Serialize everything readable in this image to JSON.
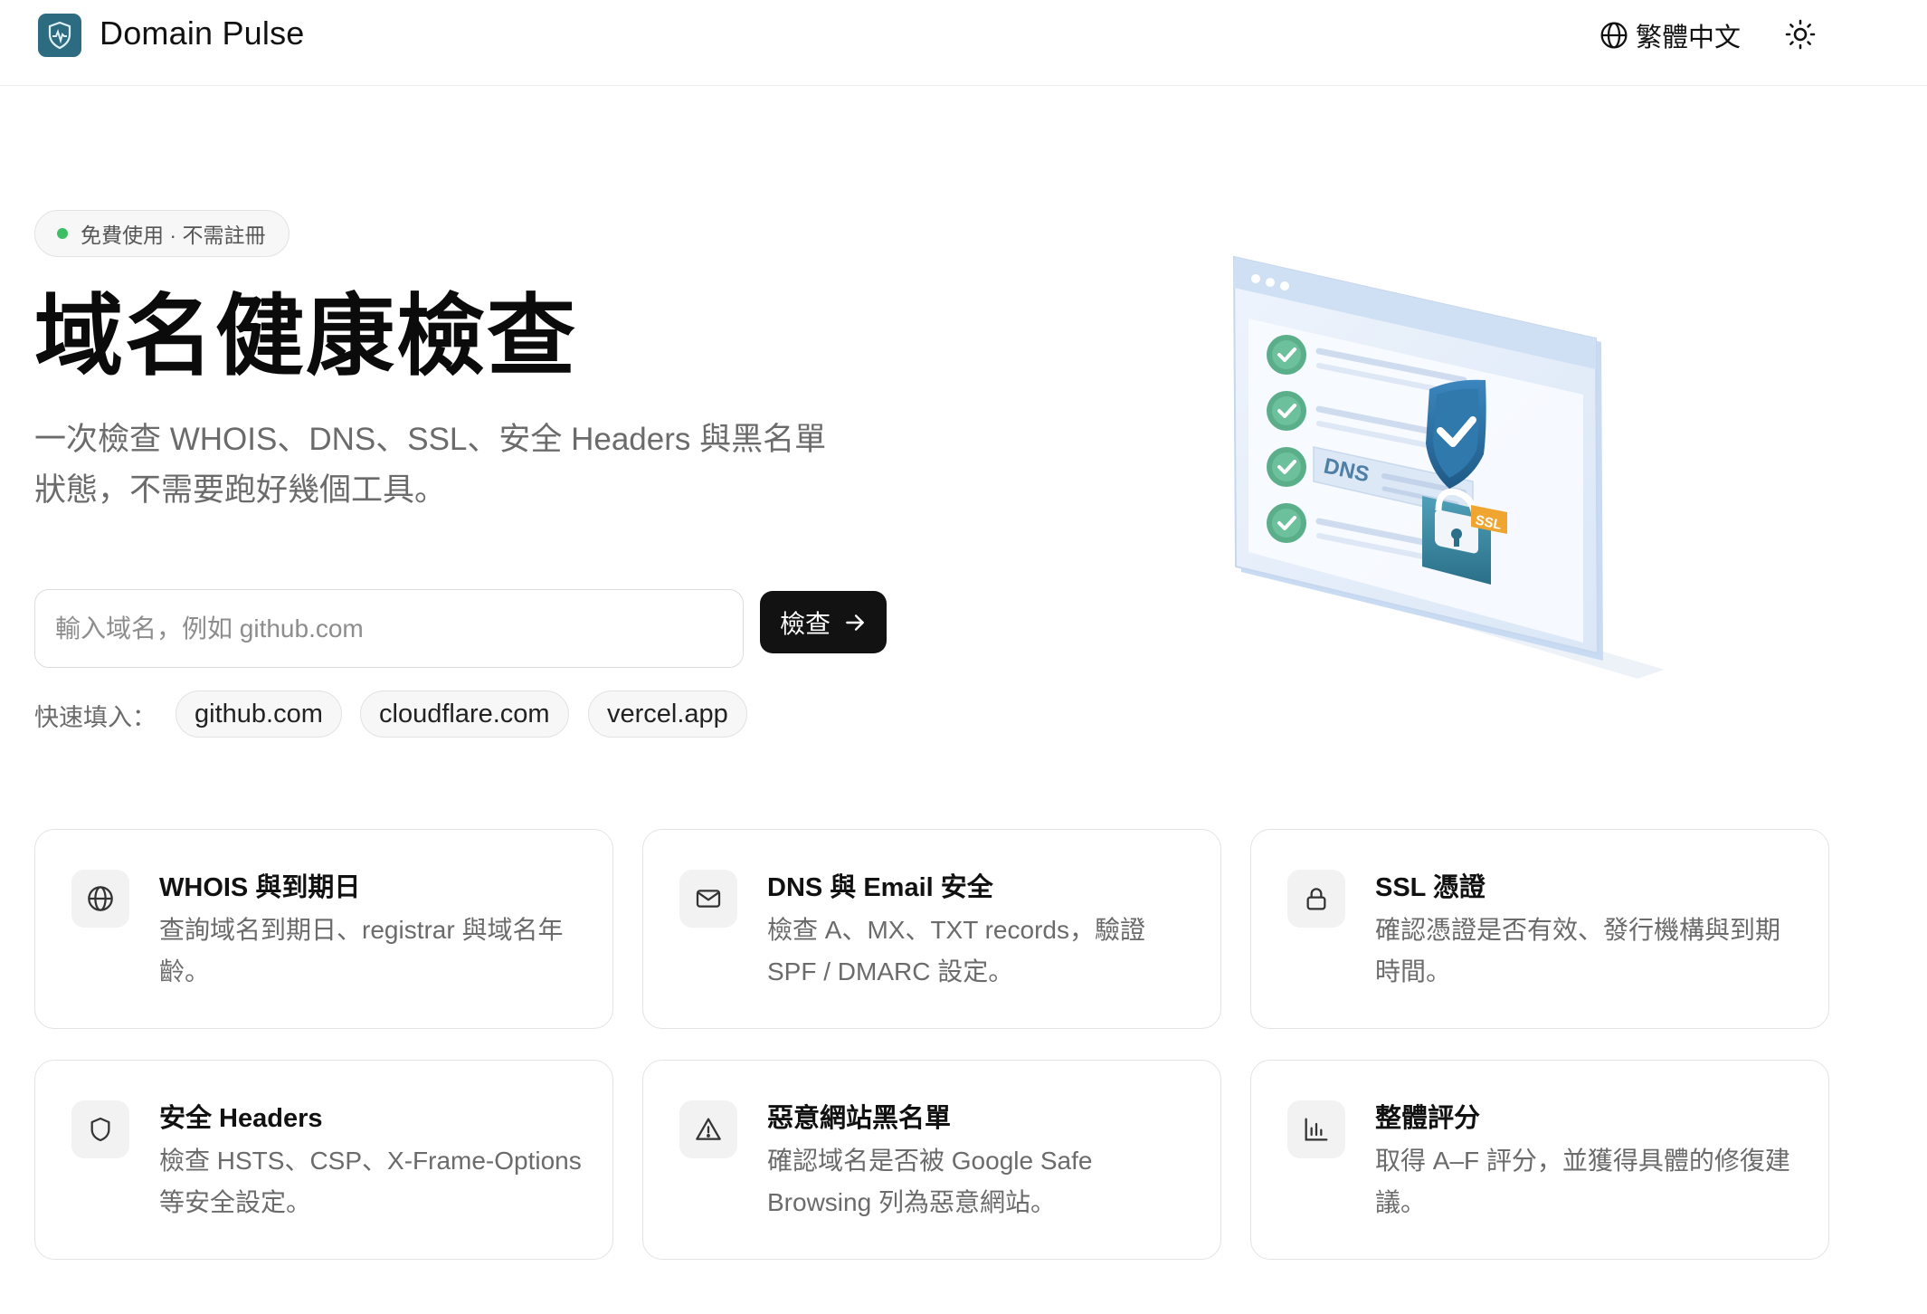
{
  "header": {
    "brand": "Domain Pulse",
    "language": "繁體中文",
    "icons": {
      "logo": "heartbeat-shield-icon",
      "language": "globe-icon",
      "theme": "sun-icon"
    }
  },
  "hero": {
    "badge": "免費使用 · 不需註冊",
    "title": "域名健康檢查",
    "subtitle": "一次檢查 WHOIS、DNS、SSL、安全 Headers 與黑名單狀態，不需要跑好幾個工具。",
    "search": {
      "placeholder": "輸入域名，例如 github.com",
      "value": ""
    },
    "check_label": "檢查",
    "quick_fill_label": "快速填入：",
    "quick_fill": [
      "github.com",
      "cloudflare.com",
      "vercel.app"
    ]
  },
  "illustration": {
    "dns_label": "DNS",
    "ssl_label": "SSL",
    "check_items": 4
  },
  "features": [
    {
      "icon": "globe-icon",
      "title": "WHOIS 與到期日",
      "desc": "查詢域名到期日、registrar 與域名年齡。"
    },
    {
      "icon": "mail-icon",
      "title": "DNS 與 Email 安全",
      "desc": "檢查 A、MX、TXT records，驗證 SPF / DMARC 設定。"
    },
    {
      "icon": "lock-icon",
      "title": "SSL 憑證",
      "desc": "確認憑證是否有效、發行機構與到期時間。"
    },
    {
      "icon": "shield-icon",
      "title": "安全 Headers",
      "desc": "檢查 HSTS、CSP、X-Frame-Options 等安全設定。"
    },
    {
      "icon": "warning-triangle-icon",
      "title": "惡意網站黑名單",
      "desc": "確認域名是否被 Google Safe Browsing 列為惡意網站。"
    },
    {
      "icon": "bar-chart-icon",
      "title": "整體評分",
      "desc": "取得 A–F 評分，並獲得具體的修復建議。"
    }
  ],
  "colors": {
    "accent": "#121212",
    "logo_bg": "#2d6b80",
    "status_dot": "#3cbf63",
    "check_green": "#5aae8a",
    "shield_blue": "#2a6a9a",
    "ssl_badge": "#f0a531"
  }
}
